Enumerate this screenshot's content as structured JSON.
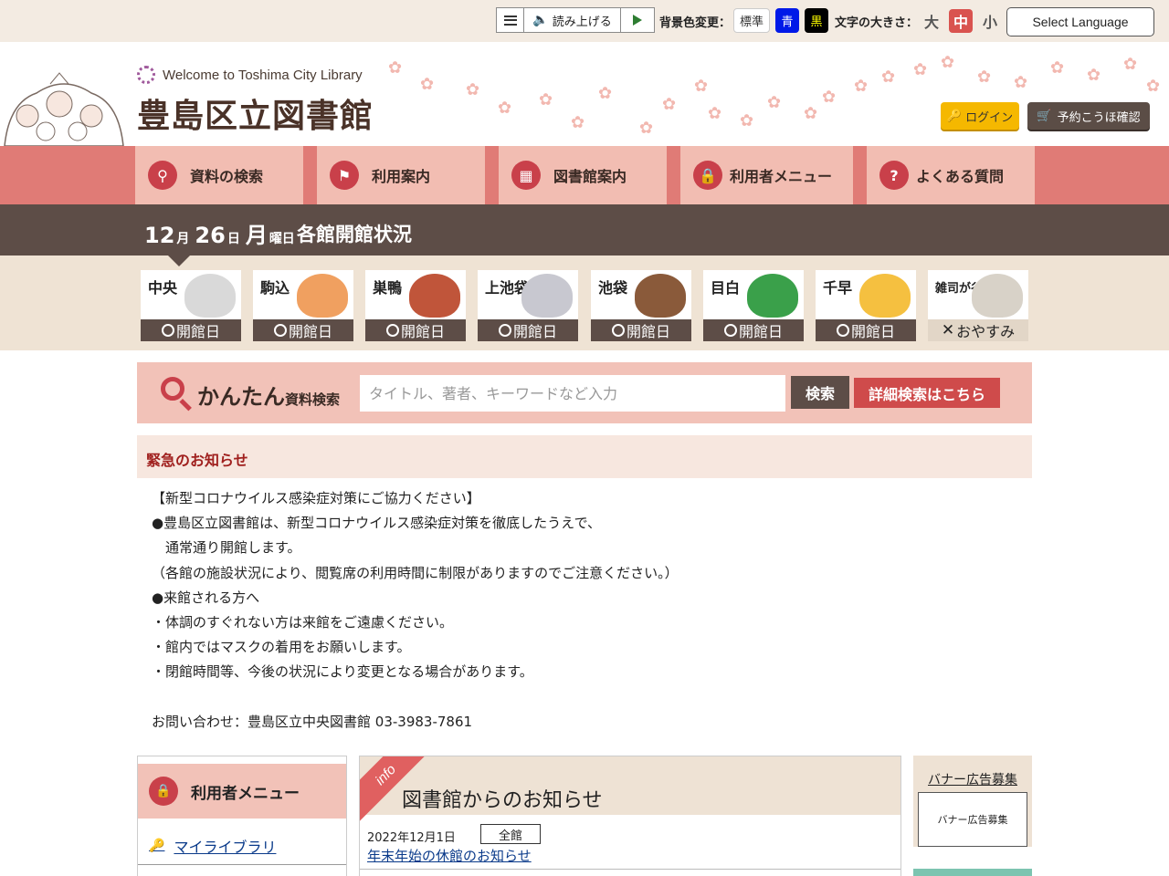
{
  "utility": {
    "read_aloud": "読み上げる",
    "bg_label": "背景色変更：",
    "bg_standard": "標準",
    "bg_blue": "青",
    "bg_black": "黒",
    "size_label": "文字の大きさ：",
    "size_large": "大",
    "size_medium": "中",
    "size_small": "小",
    "language": "Select Language"
  },
  "header": {
    "welcome": "Welcome to Toshima City Library",
    "title": "豊島区立図書館",
    "login": "ログイン",
    "reservation": "予約こうほ確認"
  },
  "nav": [
    {
      "label": "資料の検索",
      "icon": "search-icon"
    },
    {
      "label": "利用案内",
      "icon": "flag-icon"
    },
    {
      "label": "図書館案内",
      "icon": "building-icon"
    },
    {
      "label": "利用者メニュー",
      "icon": "lock-icon"
    },
    {
      "label": "よくある質問",
      "icon": "question-icon"
    }
  ],
  "datebar": {
    "month": "12",
    "month_unit": "月",
    "day": "26",
    "day_unit": "日",
    "weekday": "月",
    "weekday_unit": "曜日",
    "title": "各館開館状況"
  },
  "branches": [
    {
      "name": "中央",
      "status": "開館日",
      "open": true,
      "color": "#d9d9d9"
    },
    {
      "name": "駒込",
      "status": "開館日",
      "open": true,
      "color": "#f0a060"
    },
    {
      "name": "巣鴨",
      "status": "開館日",
      "open": true,
      "color": "#c0553a"
    },
    {
      "name": "上池袋",
      "status": "開館日",
      "open": true,
      "color": "#c8c8d0"
    },
    {
      "name": "池袋",
      "status": "開館日",
      "open": true,
      "color": "#8a5a3a"
    },
    {
      "name": "目白",
      "status": "開館日",
      "open": true,
      "color": "#3aa04a"
    },
    {
      "name": "千早",
      "status": "開館日",
      "open": true,
      "color": "#f5c040"
    },
    {
      "name": "雑司が谷",
      "status": "おやすみ",
      "open": false,
      "color": "#d8d2c8"
    }
  ],
  "search": {
    "label_big": "かんたん",
    "label_small": "資料検索",
    "placeholder": "タイトル、著者、キーワードなど入力",
    "button": "検索",
    "advanced": "詳細検索はこちら"
  },
  "emergency": {
    "title": "緊急のお知らせ",
    "lines": [
      "【新型コロナウイルス感染症対策にご協力ください】",
      "●豊島区立図書館は、新型コロナウイルス感染症対策を徹底したうえで、",
      "　通常通り開館します。",
      "（各館の施設状況により、閲覧席の利用時間に制限がありますのでご注意ください。）",
      "●来館される方へ",
      "・体調のすぐれない方は来館をご遠慮ください。",
      "・館内ではマスクの着用をお願いします。",
      "・閉館時間等、今後の状況により変更となる場合があります。",
      "",
      "お問い合わせ：豊島区立中央図書館 03-3983-7861"
    ]
  },
  "user_menu": {
    "title": "利用者メニュー",
    "my_library": "マイライブラリ"
  },
  "notices": {
    "tag": "info",
    "title": "図書館からのお知らせ",
    "items": [
      {
        "date": "2022年12月1日",
        "category": "全館",
        "title": "年末年始の休館のお知らせ"
      }
    ]
  },
  "banner": {
    "title": "バナー広告募集",
    "box": "バナー広告募集"
  },
  "colors": {
    "nav_bg": "#e07b76",
    "nav_item": "#f2bdb2",
    "accent": "#c9404a",
    "dark": "#5d4d47",
    "beige": "#efe3d4"
  }
}
